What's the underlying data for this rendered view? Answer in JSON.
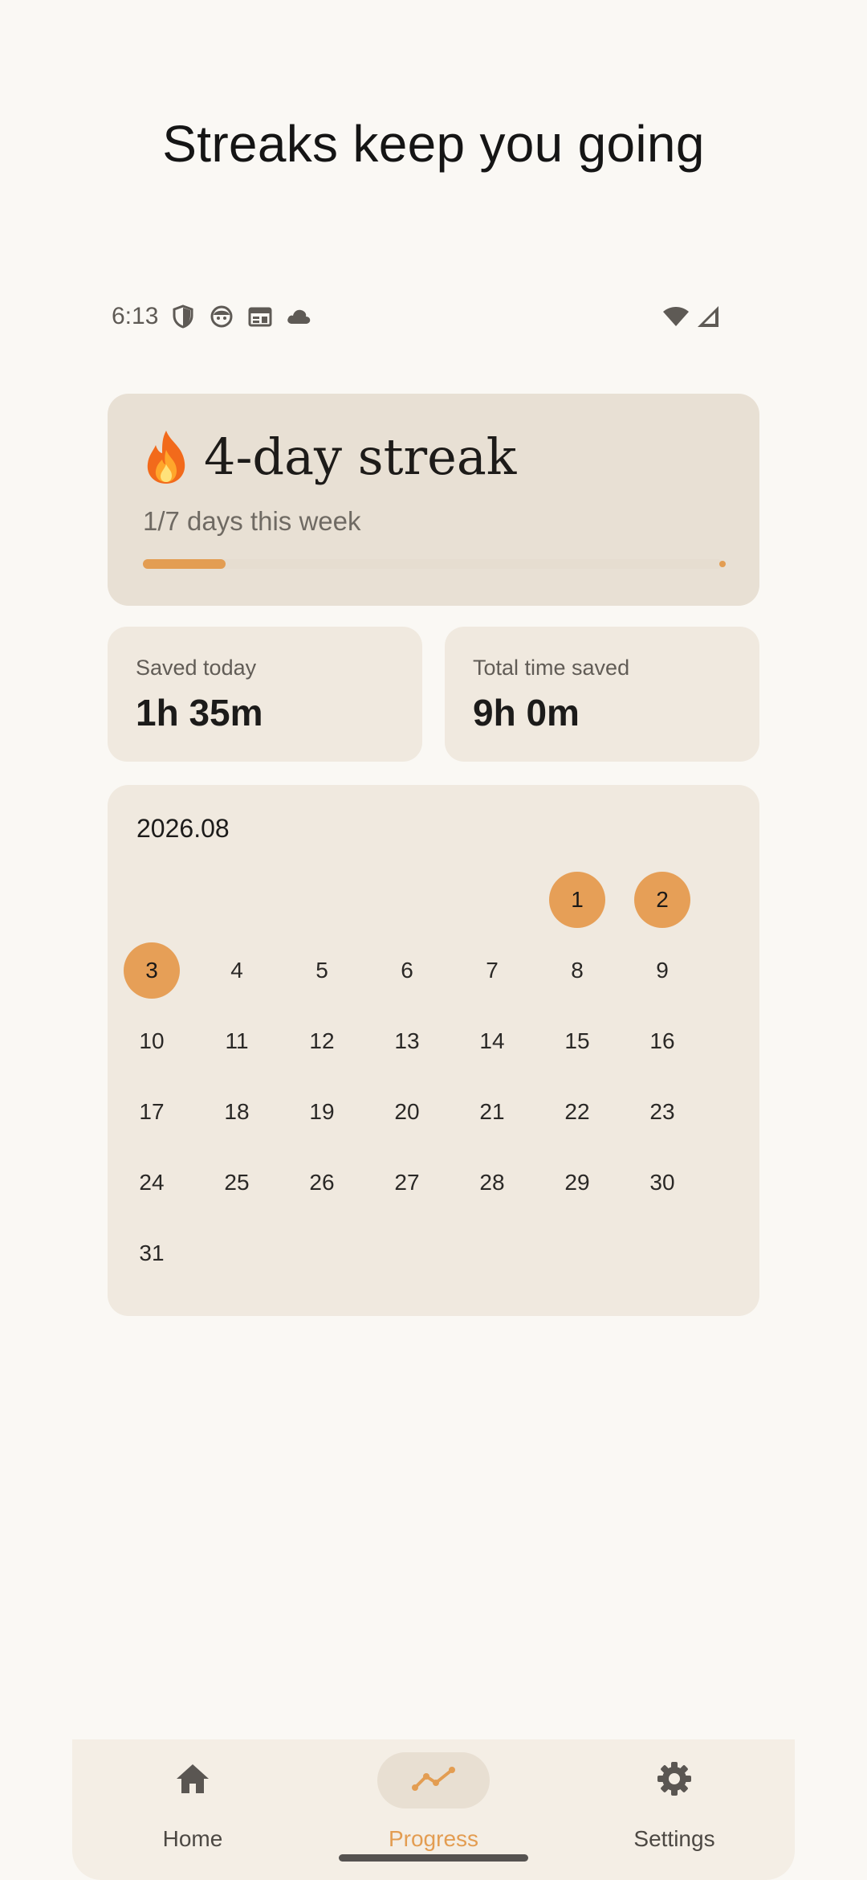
{
  "headline": "Streaks keep you going",
  "status_bar": {
    "time": "6:13",
    "left_icons": [
      "shield-icon",
      "face-icon",
      "calendar-card-icon",
      "cloud-icon"
    ],
    "right_icons": [
      "wifi-icon",
      "signal-icon"
    ]
  },
  "streak": {
    "title": "4-day streak",
    "icon": "fire-icon",
    "subtitle": "1/7 days this week",
    "progress": 0.143,
    "accent": "#e39d52"
  },
  "stats": {
    "saved_today": {
      "label": "Saved today",
      "value": "1h 35m"
    },
    "total_saved": {
      "label": "Total time saved",
      "value": "9h 0m"
    }
  },
  "calendar": {
    "month": "2026.08",
    "first_weekday_index": 5,
    "days": [
      "1",
      "2",
      "3",
      "4",
      "5",
      "6",
      "7",
      "8",
      "9",
      "10",
      "11",
      "12",
      "13",
      "14",
      "15",
      "16",
      "17",
      "18",
      "19",
      "20",
      "21",
      "22",
      "23",
      "24",
      "25",
      "26",
      "27",
      "28",
      "29",
      "30",
      "31"
    ],
    "active_days": [
      "1",
      "2",
      "3"
    ],
    "active_color": "#e69f57"
  },
  "nav": {
    "items": [
      {
        "label": "Home",
        "icon": "home-icon",
        "active": false
      },
      {
        "label": "Progress",
        "icon": "trend-icon",
        "active": true
      },
      {
        "label": "Settings",
        "icon": "gear-icon",
        "active": false
      }
    ]
  }
}
